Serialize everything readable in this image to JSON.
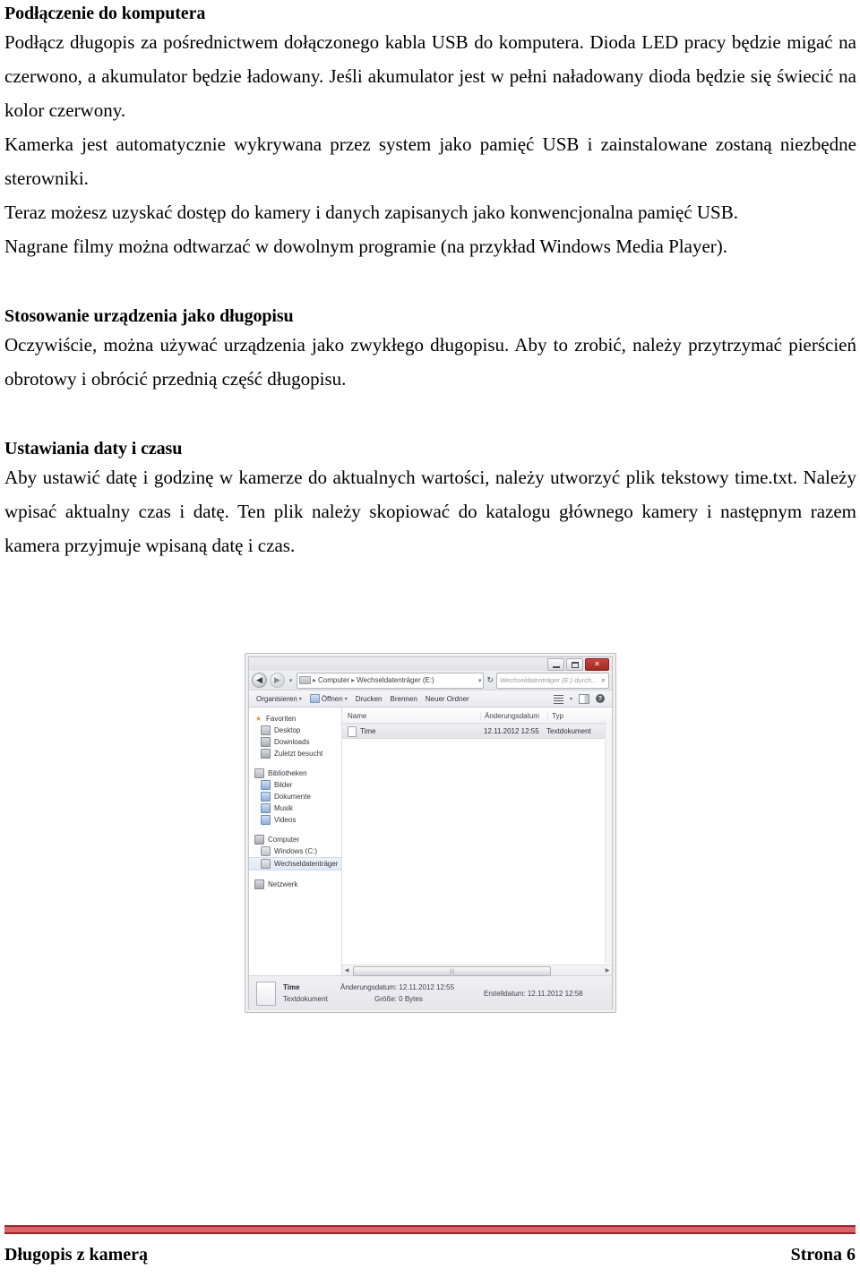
{
  "document": {
    "sections": [
      {
        "heading": "Podłączenie do komputera",
        "paragraphs": [
          "Podłącz długopis za pośrednictwem dołączonego kabla USB do komputera. Dioda LED pracy będzie migać na czerwono, a akumulator będzie ładowany. Jeśli akumulator jest w pełni naładowany dioda będzie się świecić na kolor czerwony.",
          "Kamerka jest automatycznie wykrywana przez system jako pamięć USB i zainstalowane zostaną niezbędne sterowniki.",
          "Teraz możesz uzyskać dostęp do kamery i danych zapisanych jako konwencjonalna pamięć USB.",
          "Nagrane filmy można odtwarzać w dowolnym programie (na przykład Windows Media Player)."
        ]
      },
      {
        "heading": "Stosowanie urządzenia jako długopisu",
        "paragraphs": [
          "Oczywiście, można używać urządzenia jako zwykłego długopisu. Aby to zrobić, należy przytrzymać pierścień obrotowy i obrócić przednią część długopisu."
        ]
      },
      {
        "heading": "Ustawiania daty i czasu",
        "paragraphs": [
          "Aby ustawić datę i godzinę w kamerze do aktualnych wartości, należy utworzyć plik tekstowy time.txt. Należy wpisać aktualny czas i datę. Ten plik należy skopiować do katalogu głównego kamery i następnym razem kamera przyjmuje wpisaną datę i czas."
        ]
      }
    ]
  },
  "screenshot": {
    "window_controls": {
      "minimize": "–",
      "maximize": "□",
      "close": "✕"
    },
    "address_bar": {
      "back_icon": "◀",
      "forward_icon": "▶",
      "history_caret": "▾",
      "breadcrumb": [
        "Computer",
        "Wechseldatenträger (E:)"
      ],
      "breadcrumb_separator": "▸",
      "dropdown_caret": "▾",
      "refresh_icon": "↻",
      "search_placeholder": "Wechseldatenträger (E:) durch...",
      "search_icon": "⌕"
    },
    "toolbar": {
      "items": [
        {
          "label": "Organisieren",
          "caret": "▾",
          "icon": false
        },
        {
          "label": "Öffnen",
          "caret": "▾",
          "icon": true
        },
        {
          "label": "Drucken",
          "caret": "",
          "icon": false
        },
        {
          "label": "Brennen",
          "caret": "",
          "icon": false
        },
        {
          "label": "Neuer Ordner",
          "caret": "",
          "icon": false
        }
      ],
      "view_caret": "▾",
      "help_glyph": "?"
    },
    "sidebar": {
      "groups": [
        {
          "header": {
            "label": "Favoriten",
            "icon": "star-icon"
          },
          "items": [
            {
              "label": "Desktop",
              "icon": "desktop-icon"
            },
            {
              "label": "Downloads",
              "icon": "downloads-icon"
            },
            {
              "label": "Zuletzt besucht",
              "icon": "recent-icon"
            }
          ]
        },
        {
          "header": {
            "label": "Bibliotheken",
            "icon": "library-icon"
          },
          "items": [
            {
              "label": "Bilder",
              "icon": "pictures-icon"
            },
            {
              "label": "Dokumente",
              "icon": "documents-icon"
            },
            {
              "label": "Musik",
              "icon": "music-icon"
            },
            {
              "label": "Videos",
              "icon": "videos-icon"
            }
          ]
        },
        {
          "header": {
            "label": "Computer",
            "icon": "computer-icon"
          },
          "items": [
            {
              "label": "Windows (C:)",
              "icon": "harddisk-icon"
            },
            {
              "label": "Wechseldatenträger",
              "icon": "removable-drive-icon",
              "selected": true
            }
          ]
        },
        {
          "header": {
            "label": "Netzwerk",
            "icon": "network-icon"
          },
          "items": []
        }
      ]
    },
    "file_list": {
      "columns": [
        "Name",
        "Änderungsdatum",
        "Typ"
      ],
      "rows": [
        {
          "name": "Time",
          "modified": "12.11.2012 12:55",
          "type": "Textdokument"
        }
      ],
      "scroll_thumb_grip": "|||",
      "scroll_left_arrow": "◀",
      "scroll_right_arrow": "▶"
    },
    "details_pane": {
      "file_name": "Time",
      "file_type": "Textdokument",
      "modified_label": "Änderungsdatum:",
      "modified_value": "12.11.2012 12:55",
      "size_label": "Größe:",
      "size_value": "0 Bytes",
      "created_label": "Erstelldatum:",
      "created_value": "12.11.2012 12:58"
    }
  },
  "footer": {
    "left": "Długopis z kamerą",
    "right": "Strona 6",
    "rule_color": "#97242a",
    "rule_inner_color": "#d9646a"
  }
}
